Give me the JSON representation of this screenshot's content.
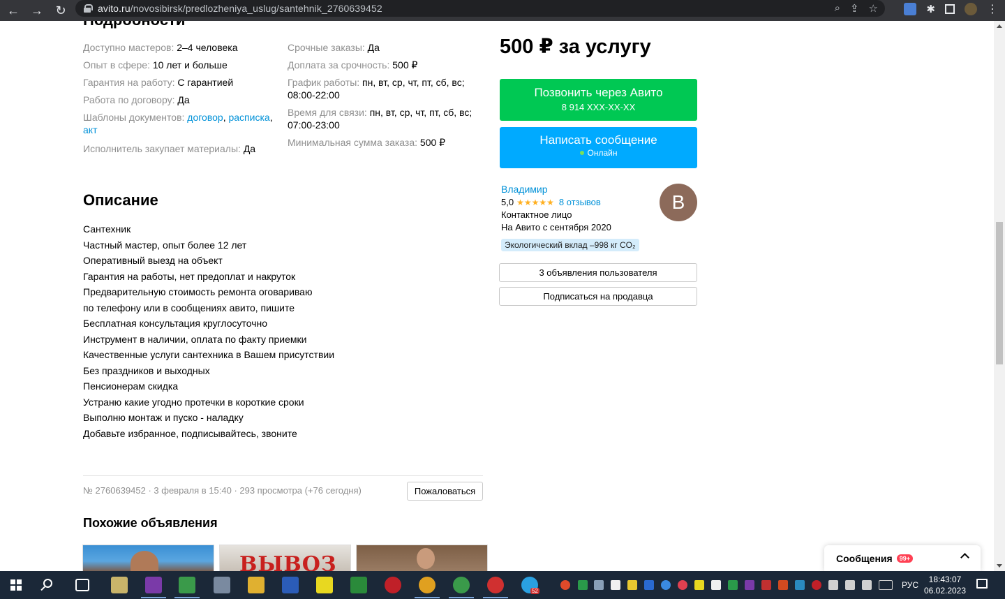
{
  "browser": {
    "url_host": "avito.ru",
    "url_path": "/novosibirsk/predlozheniya_uslug/santehnik_2760639452"
  },
  "details": {
    "title": "Подробности",
    "left": [
      {
        "label": "Доступно мастеров:",
        "value": "2–4 человека"
      },
      {
        "label": "Опыт в сфере:",
        "value": "10 лет и больше"
      },
      {
        "label": "Гарантия на работу:",
        "value": "С гарантией"
      },
      {
        "label": "Работа по договору:",
        "value": "Да"
      },
      {
        "label": "Шаблоны документов:",
        "links": [
          "договор",
          "расписка",
          "акт"
        ]
      },
      {
        "label": "Исполнитель закупает материалы:",
        "value": "Да"
      }
    ],
    "right": [
      {
        "label": "Срочные заказы:",
        "value": "Да"
      },
      {
        "label": "Доплата за срочность:",
        "value": "500 ₽"
      },
      {
        "label": "График работы:",
        "value": "пн, вт, ср, чт, пт, сб, вс; 08:00-22:00"
      },
      {
        "label": "Время для связи:",
        "value": "пн, вт, ср, чт, пт, сб, вс; 07:00-23:00"
      },
      {
        "label": "Минимальная сумма заказа:",
        "value": "500 ₽"
      }
    ]
  },
  "description": {
    "title": "Описание",
    "lines": [
      "Сантехник",
      "Частный мастер, опыт более 12 лет",
      "Оперативный выезд на объект",
      "Гарантия на работы, нет предоплат и накруток",
      "Предварительную стоимость ремонта оговариваю",
      "по телефону или в сообщениях авито, пишите",
      "Бесплатная консультация круглосуточно",
      "Инструмент в наличии, оплата по факту приемки",
      "Качественные услуги сантехника в Вашем присутствии",
      "Без праздников и выходных",
      "Пенсионерам скидка",
      "Устраню какие угодно протечки в короткие сроки",
      "Выполню монтаж и пуско - наладку",
      "Добавьте избранное, подписывайтесь, звоните"
    ]
  },
  "meta": {
    "text": "№ 2760639452 · 3 февраля в 15:40 · 293 просмотра (+76 сегодня)",
    "report_label": "Пожаловаться"
  },
  "similar": {
    "title": "Похожие объявления",
    "thumb2_text": "ВЫВОЗ"
  },
  "offer": {
    "price": "500 ₽ за услугу",
    "call_label": "Позвонить через Авито",
    "call_phone": "8 914 XXX-XX-XX",
    "message_label": "Написать сообщение",
    "online_label": "Онлайн"
  },
  "seller": {
    "name": "Владимир",
    "rating": "5,0",
    "stars": "★★★★★",
    "reviews": "8 отзывов",
    "role": "Контактное лицо",
    "since": "На Авито с сентября 2020",
    "eco": "Экологический вклад –998 кг CO₂",
    "avatar_letter": "В",
    "ads_button": "3 объявления пользователя",
    "subscribe_button": "Подписаться на продавца"
  },
  "messages_widget": {
    "label": "Сообщения",
    "badge": "99+"
  },
  "taskbar": {
    "lang": "РУС",
    "time": "18:43:07",
    "date": "06.02.2023",
    "telegram_badge": "52"
  },
  "colors": {
    "call_green": "#00c853",
    "message_blue": "#00aaff",
    "link_blue": "#0091d8",
    "label_gray": "#8f8f8f"
  }
}
